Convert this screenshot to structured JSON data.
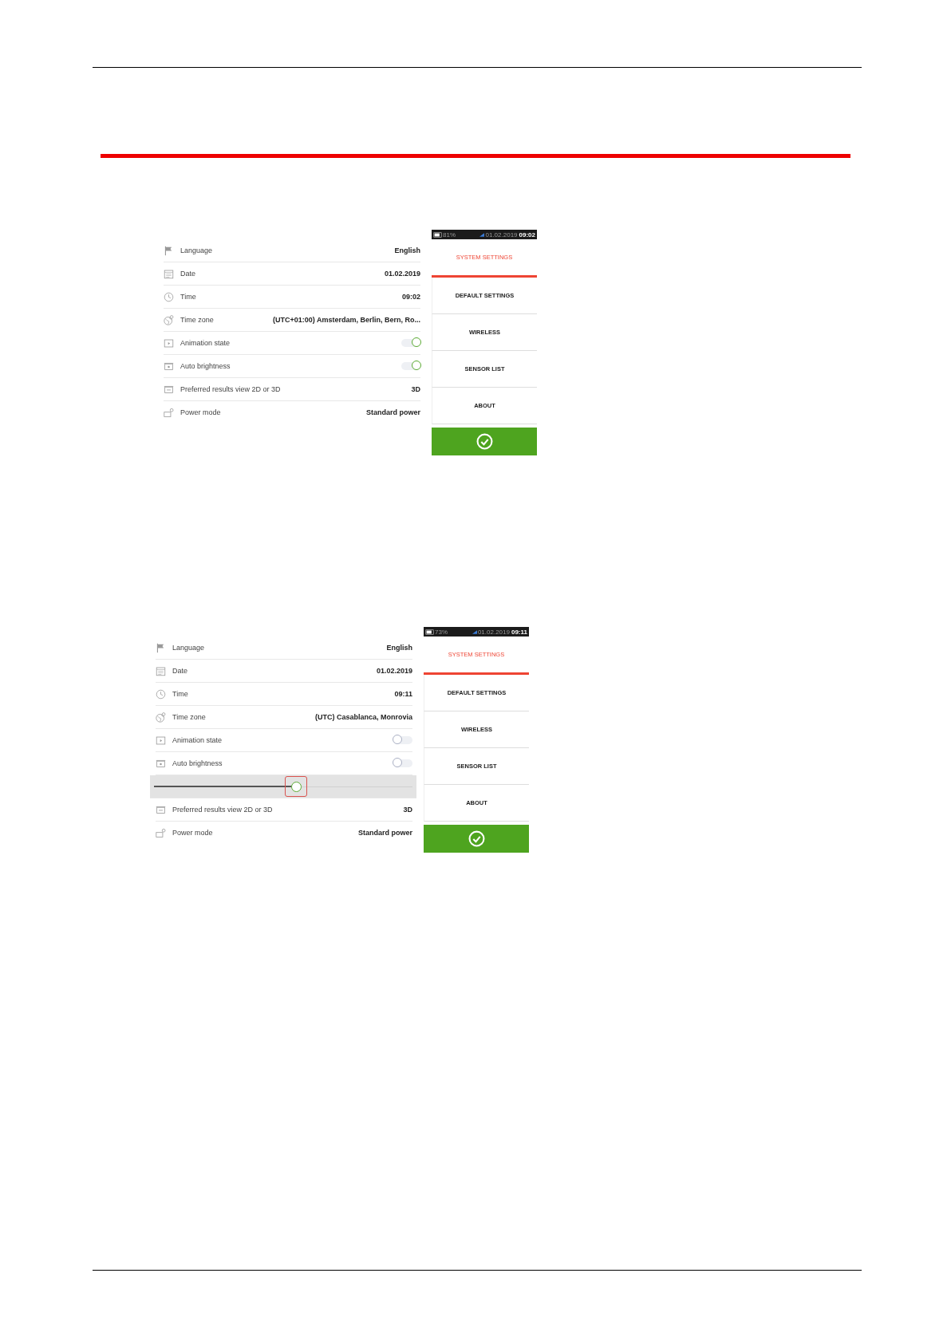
{
  "screens": [
    {
      "status_bar": {
        "battery": "81%",
        "date": "01.02.2019",
        "time": "09:02"
      },
      "rows": [
        {
          "kind": "value",
          "label": "Language",
          "value": "English"
        },
        {
          "kind": "value",
          "label": "Date",
          "value": "01.02.2019"
        },
        {
          "kind": "value",
          "label": "Time",
          "value": "09:02"
        },
        {
          "kind": "value",
          "label": "Time zone",
          "value": "(UTC+01:00) Amsterdam, Berlin, Bern, Ro..."
        },
        {
          "kind": "toggle",
          "label": "Animation state",
          "on": true
        },
        {
          "kind": "toggle",
          "label": "Auto brightness",
          "on": true
        },
        {
          "kind": "value",
          "label": "Preferred results view 2D or 3D",
          "value": "3D"
        },
        {
          "kind": "value",
          "label": "Power mode",
          "value": "Standard power"
        }
      ],
      "menu": [
        {
          "label": "SYSTEM SETTINGS",
          "selected": true
        },
        {
          "label": "DEFAULT SETTINGS",
          "selected": false
        },
        {
          "label": "WIRELESS",
          "selected": false
        },
        {
          "label": "SENSOR LIST",
          "selected": false
        },
        {
          "label": "ABOUT",
          "selected": false
        }
      ]
    },
    {
      "status_bar": {
        "battery": "73%",
        "date": "01.02.2019",
        "time": "09:11"
      },
      "rows": [
        {
          "kind": "value",
          "label": "Language",
          "value": "English"
        },
        {
          "kind": "value",
          "label": "Date",
          "value": "01.02.2019"
        },
        {
          "kind": "value",
          "label": "Time",
          "value": "09:11"
        },
        {
          "kind": "value",
          "label": "Time zone",
          "value": "(UTC) Casablanca, Monrovia"
        },
        {
          "kind": "toggle",
          "label": "Animation state",
          "on": false
        },
        {
          "kind": "toggle",
          "label": "Auto brightness",
          "on": false
        },
        {
          "kind": "slider",
          "level": 0.55
        },
        {
          "kind": "value",
          "label": "Preferred results view 2D or 3D",
          "value": "3D"
        },
        {
          "kind": "value",
          "label": "Power mode",
          "value": "Standard power"
        }
      ],
      "menu": [
        {
          "label": "SYSTEM SETTINGS",
          "selected": true
        },
        {
          "label": "DEFAULT SETTINGS",
          "selected": false
        },
        {
          "label": "WIRELESS",
          "selected": false
        },
        {
          "label": "SENSOR LIST",
          "selected": false
        },
        {
          "label": "ABOUT",
          "selected": false
        }
      ]
    }
  ]
}
